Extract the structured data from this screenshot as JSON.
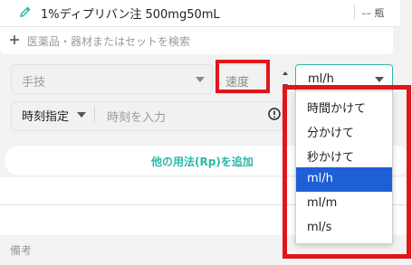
{
  "drug": {
    "name": "1%ディプリバン注 500mg50mL",
    "unit": "–– 瓶",
    "icon": "pencil-icon"
  },
  "search": {
    "placeholder": "医薬品・器材またはセットを検索",
    "icon": "plus-icon"
  },
  "technique": {
    "placeholder": "手技"
  },
  "speed": {
    "placeholder": "速度"
  },
  "unit_select": {
    "value": "ml/h",
    "options": [
      "時間かけて",
      "分かけて",
      "秒かけて",
      "ml/h",
      "ml/m",
      "ml/s"
    ],
    "selected_index": 3
  },
  "time": {
    "mode": "時刻指定",
    "placeholder": "時刻を入力"
  },
  "add_regimen": {
    "label": "他の用法(Rp)を追加"
  },
  "notes": {
    "label": "備考"
  },
  "colors": {
    "accent": "#2bb8a8",
    "highlight_red": "#e0161b",
    "selected_blue": "#1f5fd6"
  }
}
